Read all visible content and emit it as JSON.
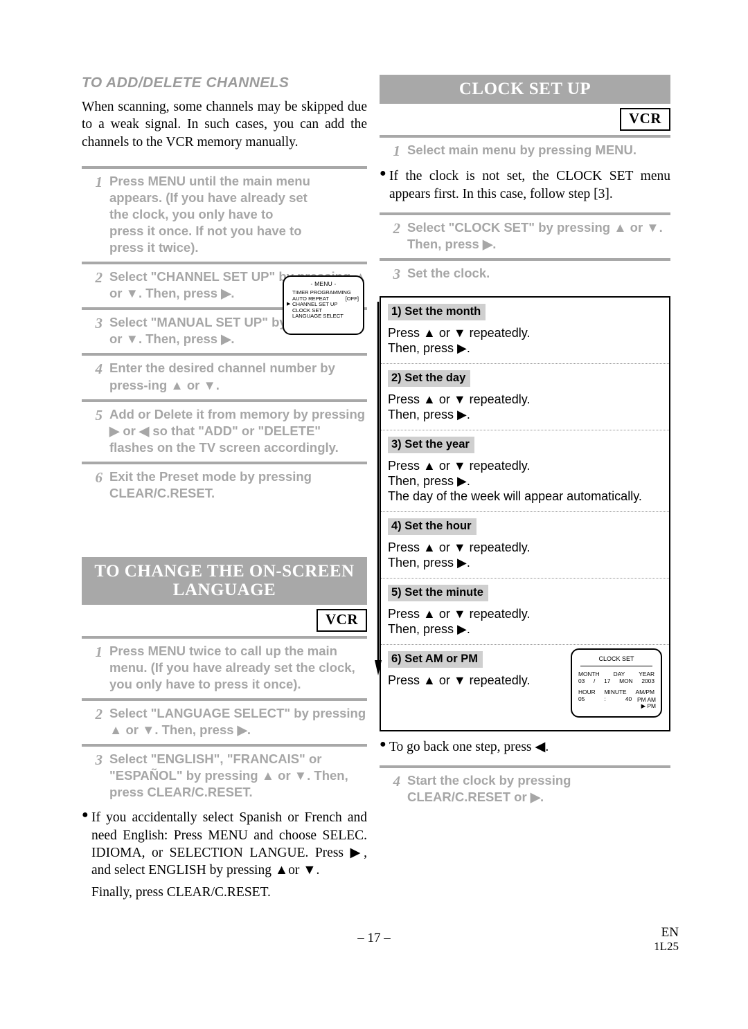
{
  "left_column": {
    "section1": {
      "title": "TO ADD/DELETE CHANNELS",
      "intro": "When scanning, some channels may be skipped due to a weak signal. In such cases, you can add  the channels to the VCR memory manually.",
      "steps": [
        {
          "num": "1",
          "text": "Press MENU until the main menu appears. (If you have already set the clock, you only have to press it once.  If not you have to press it twice)."
        },
        {
          "num": "2",
          "text": "Select \"CHANNEL SET UP\" by pressing ▲ or ▼. Then, press ▶."
        },
        {
          "num": "3",
          "text": "Select \"MANUAL SET UP\" by pressing ▲ or ▼. Then, press ▶."
        },
        {
          "num": "4",
          "text": "Enter the desired channel number by press-ing ▲ or ▼."
        },
        {
          "num": "5",
          "text": "Add or Delete it from memory by pressing ▶ or ◀ so that \"ADD\" or \"DELETE\" flashes on the TV screen accordingly."
        },
        {
          "num": "6",
          "text": "Exit the Preset mode by pressing CLEAR/C.RESET."
        }
      ],
      "osd_menu": {
        "title": "- MENU -",
        "items": [
          {
            "label": "TIMER PROGRAMMING",
            "value": "",
            "cursor": false
          },
          {
            "label": "AUTO REPEAT",
            "value": "[OFF]",
            "cursor": false
          },
          {
            "label": "CHANNEL SET UP",
            "value": "",
            "cursor": true
          },
          {
            "label": "CLOCK SET",
            "value": "",
            "cursor": false
          },
          {
            "label": "LANGUAGE SELECT",
            "value": "",
            "cursor": false
          }
        ],
        "cursor_glyph": "▶"
      }
    },
    "section2": {
      "banner_line1": "TO CHANGE THE ON-SCREEN",
      "banner_line2": "LANGUAGE",
      "vcr_badge": "VCR",
      "steps": [
        {
          "num": "1",
          "text": "Press MENU twice to call up the main menu. (If you have already set the clock, you only have to press it once)."
        },
        {
          "num": "2",
          "text": "Select \"LANGUAGE SELECT\" by pressing ▲ or ▼. Then, press ▶."
        },
        {
          "num": "3",
          "text": "Select \"ENGLISH\", \"FRANCAIS\" or \"ESPAÑOL\" by pressing ▲ or ▼. Then, press CLEAR/C.RESET."
        }
      ],
      "note_bullet": "If you accidentally select Spanish or French and need English: Press MENU and choose SELEC. IDIOMA, or SELECTION LANGUE. Press ▶, and select ENGLISH by pressing ▲or ▼.",
      "note_final": "Finally, press CLEAR/C.RESET."
    }
  },
  "right_column": {
    "banner": "CLOCK SET UP",
    "vcr_badge": "VCR",
    "step1": {
      "num": "1",
      "text": "Select main menu by pressing MENU."
    },
    "note_bullet": "If the clock is not set, the CLOCK SET menu appears first. In this case, follow step [3].",
    "step2": {
      "num": "2",
      "text": "Select \"CLOCK SET\" by pressing ▲ or ▼. Then, press ▶."
    },
    "step3": {
      "num": "3",
      "text": "Set the clock."
    },
    "clock_substeps": [
      {
        "label": "1) Set the month",
        "lines": [
          "Press ▲ or ▼ repeatedly.",
          "Then, press ▶."
        ]
      },
      {
        "label": "2) Set the day",
        "lines": [
          "Press ▲ or ▼ repeatedly.",
          "Then, press ▶."
        ]
      },
      {
        "label": "3) Set the year",
        "lines": [
          "Press ▲ or ▼ repeatedly.",
          "Then, press ▶.",
          "The day of the week will appear automatically."
        ]
      },
      {
        "label": "4) Set the hour",
        "lines": [
          "Press ▲ or ▼ repeatedly.",
          "Then, press ▶."
        ]
      },
      {
        "label": "5) Set the minute",
        "lines": [
          "Press ▲ or ▼ repeatedly.",
          "Then, press ▶."
        ]
      },
      {
        "label": "6) Set AM or PM",
        "lines": [
          "Press ▲ or ▼ repeatedly."
        ]
      }
    ],
    "osd_clock": {
      "title": "CLOCK SET",
      "label_month": "MONTH",
      "label_day": "DAY",
      "label_year": "YEAR",
      "value_month": "03",
      "sep_date": "/",
      "value_day": "17",
      "value_weekday": "MON",
      "value_year": "2003",
      "label_hour": "HOUR",
      "label_minute": "MINUTE",
      "label_ampm": "AM/PM",
      "value_hour": "05",
      "sep_time": ":",
      "value_minute": "40",
      "ampm_pm_left": "PM",
      "ampm_am": "AM",
      "ampm_pm": "PM",
      "ampm_cursor": "▶"
    },
    "back_note": "To go back one step, press ◀.",
    "step4": {
      "num": "4",
      "text": "Start the clock by pressing CLEAR/C.RESET or ▶."
    }
  },
  "footer": {
    "page_number": "– 17 –",
    "language_code": "EN",
    "doc_code": "1L25"
  },
  "colors": {
    "banner_gray": "#a8a8a8",
    "step_text_gray": "#a6a6a6",
    "sublabel_gray": "#cfcfcf",
    "rule_gray": "#a8a8a8"
  }
}
